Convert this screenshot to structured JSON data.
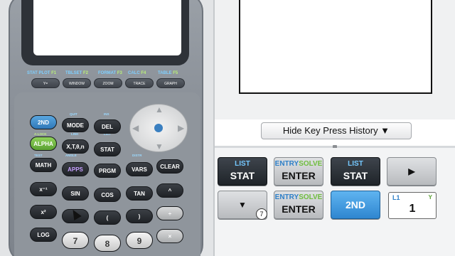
{
  "calculator": {
    "fn_labels": [
      {
        "b": "STAT PLOT",
        "g": "F1"
      },
      {
        "b": "TBLSET",
        "g": "F2"
      },
      {
        "b": "FORMAT",
        "g": "F3"
      },
      {
        "b": "CALC",
        "g": "F4"
      },
      {
        "b": "TABLE",
        "g": "F5"
      }
    ],
    "fkeys": [
      "Y=",
      "WINDOW",
      "ZOOM",
      "TRACE",
      "GRAPH"
    ],
    "keys": {
      "second": "2ND",
      "mode": "MODE",
      "del": "DEL",
      "alpha": "ALPHA",
      "xton": "X,T,θ,n",
      "stat": "STAT",
      "math": "MATH",
      "apps": "APPS",
      "prgm": "PRGM",
      "vars": "VARS",
      "clear": "CLEAR",
      "inverse": "x⁻¹",
      "sin": "SIN",
      "cos": "COS",
      "tan": "TAN",
      "power": "^",
      "square": "x²",
      "comma": ",",
      "lparen": "(",
      "rparen": ")",
      "divide": "÷",
      "log": "LOG",
      "seven": "7",
      "eight": "8",
      "nine": "9",
      "times": "×"
    },
    "tiny": {
      "quit": "QUIT",
      "ins": "INS",
      "alock": "A-LOCK",
      "link": "LINK",
      "list": "LIST",
      "test": "TEST",
      "angle": "ANGLE",
      "draw": "DRAW",
      "distr": "DISTR"
    }
  },
  "panel": {
    "history_button": "Hide Key Press History ▼",
    "history_keys": [
      {
        "sub": "LIST",
        "main": "STAT"
      },
      {
        "sub_b": "ENTRY",
        "sub_g": "SOLVE",
        "main": "ENTER"
      },
      {
        "sub": "LIST",
        "main": "STAT"
      },
      {
        "main": "▶"
      },
      {
        "main": "▼"
      },
      {
        "sub_b": "ENTRY",
        "sub_g": "SOLVE",
        "main": "ENTER"
      },
      {
        "main": "2ND"
      }
    ],
    "badge": "7",
    "list_cell": {
      "label": "L1",
      "col": "Y",
      "value": "1"
    }
  },
  "colors": {
    "accent_blue": "#2f86d0",
    "key_dark": "#1f2429",
    "key_light": "#b8bbbe"
  }
}
